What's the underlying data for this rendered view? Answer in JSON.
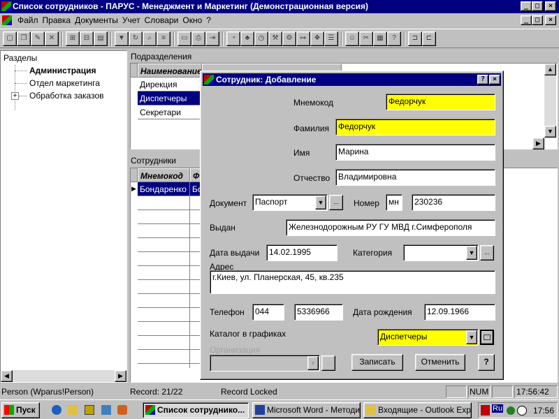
{
  "window": {
    "title": "Список сотрудников - ПАРУС - Менеджмент и Маркетинг (Демонстрационная версия)",
    "min": "_",
    "max": "□",
    "close": "×"
  },
  "menu": {
    "items": [
      "Файл",
      "Правка",
      "Документы",
      "Учет",
      "Словари",
      "Окно",
      "?"
    ],
    "child_min": "_",
    "child_max": "□",
    "child_close": "×"
  },
  "sections": {
    "header": "Разделы",
    "items": [
      {
        "label": "Администрация",
        "bold": true
      },
      {
        "label": "Отдел маркетинга",
        "bold": false
      },
      {
        "label": "Обработка заказов",
        "bold": false
      }
    ],
    "expand": "+"
  },
  "departments": {
    "header": "Подразделения",
    "column": "Наименование",
    "rows": [
      "Дирекция",
      "Диспетчеры",
      "Секретари"
    ],
    "selected_index": 1
  },
  "employees": {
    "header": "Сотрудники",
    "columns": [
      "Мнемокод",
      "Ф"
    ],
    "rows": [
      [
        "Бондаренко",
        "Бо"
      ]
    ],
    "row_marker": "▶"
  },
  "dialog": {
    "title": "Сотрудник: Добавление",
    "help": "?",
    "close": "×",
    "fields": {
      "mnemocode": {
        "label": "Мнемокод",
        "value": "Федорчук"
      },
      "surname": {
        "label": "Фамилия",
        "value": "Федорчук"
      },
      "name": {
        "label": "Имя",
        "value": "Марина"
      },
      "patronymic": {
        "label": "Отчество",
        "value": "Владимировна"
      },
      "document": {
        "label": "Документ",
        "value": "Паспорт"
      },
      "number": {
        "label": "Номер",
        "series": "мн",
        "value": "230236"
      },
      "issued_by": {
        "label": "Выдан",
        "value": "Железнодорожным РУ ГУ МВД г.Симферополя"
      },
      "issue_date": {
        "label": "Дата выдачи",
        "value": "14.02.1995"
      },
      "category": {
        "label": "Категория",
        "value": ""
      },
      "address": {
        "label": "Адрес",
        "value": "г.Киев, ул. Планерская, 45, кв.235"
      },
      "phone": {
        "label": "Телефон",
        "code": "044",
        "value": "5336966"
      },
      "birth_date": {
        "label": "Дата рождения",
        "value": "12.09.1966"
      },
      "catalog": {
        "label": "Каталог в графиках",
        "value": "Диспетчеры"
      },
      "organization": {
        "label": "Организация",
        "value": ""
      }
    },
    "ellipsis": "...",
    "dropdown": "▼",
    "buttons": {
      "save": "Записать",
      "cancel": "Отменить",
      "help": "?"
    }
  },
  "status": {
    "user": "Person (Wparus!Person)",
    "record": "Record: 21/22",
    "lock": "Record Locked",
    "num": "NUM",
    "time": "17:56:42"
  },
  "taskbar": {
    "start": "Пуск",
    "tasks": [
      "Список сотруднико...",
      "Microsoft Word - Методи...",
      "Входящие - Outlook Expr..."
    ],
    "lang": "Ru",
    "clock": "17:56"
  },
  "colors": {
    "title_bg": "#000080",
    "highlight": "#ffff00",
    "face": "#c0c0c0"
  }
}
